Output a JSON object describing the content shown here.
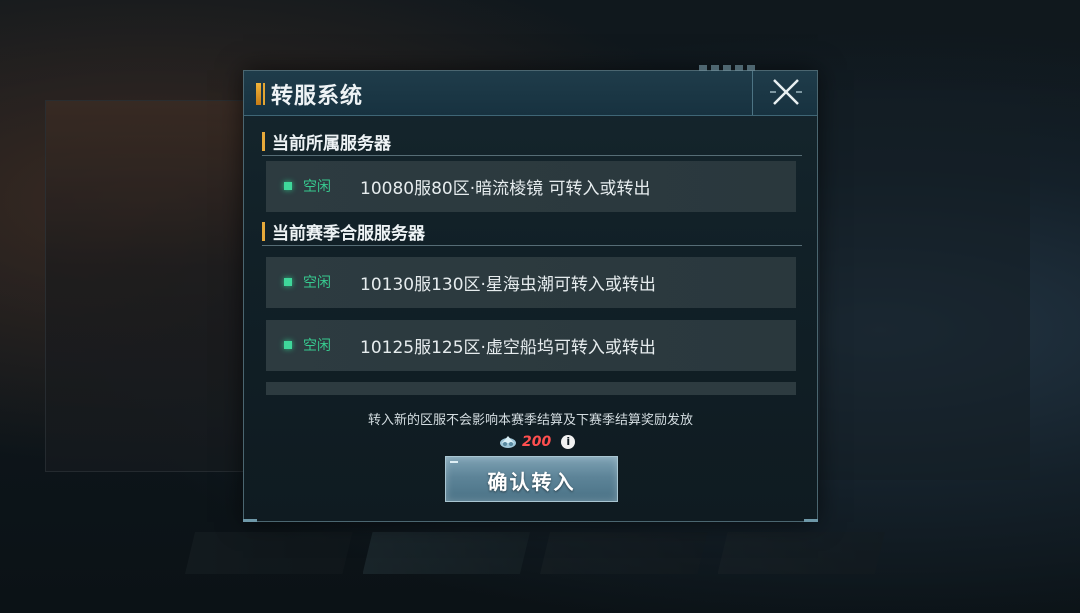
{
  "dialog": {
    "title": "转服系统",
    "close_icon": "close-x-icon"
  },
  "current_server": {
    "section_title": "当前所属服务器",
    "rows": [
      {
        "status": "空闲",
        "name": "10080服80区·暗流棱镜 可转入或转出"
      }
    ]
  },
  "merged_servers": {
    "section_title": "当前赛季合服服务器",
    "rows": [
      {
        "status": "空闲",
        "name": "10130服130区·星海虫潮可转入或转出"
      },
      {
        "status": "空闲",
        "name": "10125服125区·虚空船坞可转入或转出"
      }
    ]
  },
  "notice": "转入新的区服不会影响本赛季结算及下赛季结算奖励发放",
  "cost": {
    "icon": "currency-icon",
    "value": "200",
    "info_icon": "info-icon"
  },
  "confirm_label": "确认转入",
  "colors": {
    "status_idle": "#37c98f",
    "cost_value": "#ff4f4f",
    "accent": "#e7a93a"
  }
}
